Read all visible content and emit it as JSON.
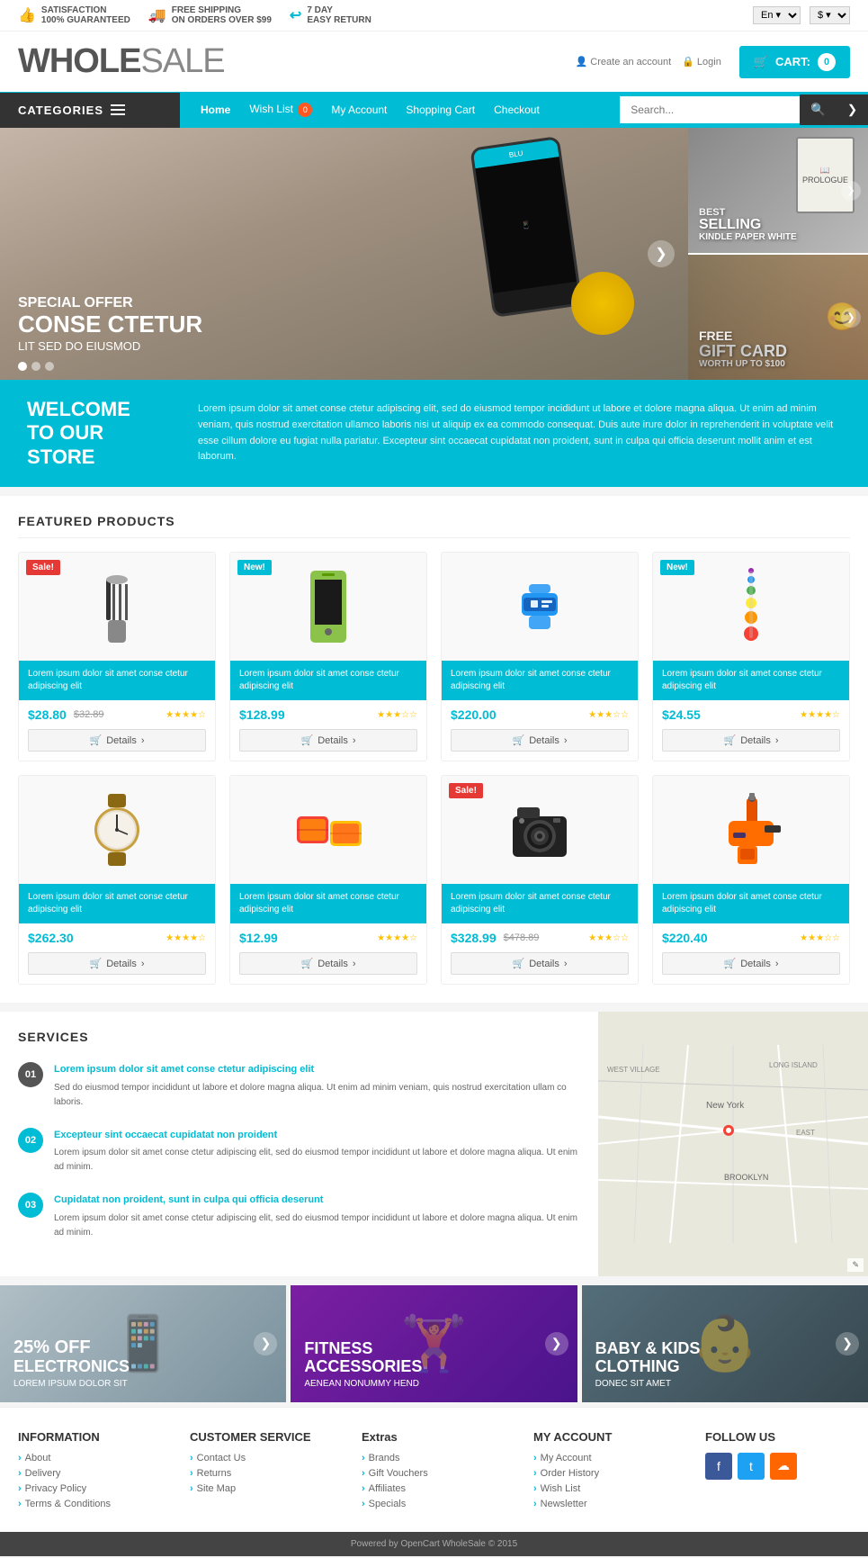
{
  "topbar": {
    "feature1_icon": "👍",
    "feature1_line1": "SATISFACTION",
    "feature1_line2": "100% GUARANTEED",
    "feature2_icon": "🚚",
    "feature2_line1": "FREE SHIPPING",
    "feature2_line2": "ON ORDERS OVER $99",
    "feature3_icon": "↩",
    "feature3_line1": "7 DAY",
    "feature3_line2": "EASY RETURN",
    "lang": "En",
    "currency": "$"
  },
  "header": {
    "logo_part1": "WHOLE",
    "logo_part2": "SALE",
    "create_account": "Create an account",
    "login": "Login",
    "cart_label": "CART:",
    "cart_count": "0"
  },
  "nav": {
    "categories_label": "CATEGORIES",
    "links": [
      {
        "label": "Home",
        "active": true,
        "badge": null
      },
      {
        "label": "Wish List",
        "active": false,
        "badge": "0"
      },
      {
        "label": "My Account",
        "active": false,
        "badge": null
      },
      {
        "label": "Shopping Cart",
        "active": false,
        "badge": null
      },
      {
        "label": "Checkout",
        "active": false,
        "badge": null
      }
    ],
    "search_placeholder": "Search..."
  },
  "hero": {
    "main": {
      "tag": "SPECIAL OFFER",
      "title": "CONSE CTETUR",
      "subtitle": "LIT SED DO EIUSMOD"
    },
    "side1": {
      "label": "BEST",
      "title": "SELLING",
      "sub": "KINDLE PAPER WHITE"
    },
    "side2": {
      "label": "FREE",
      "title": "GIFT CARD",
      "sub": "WORTH UP TO $100"
    }
  },
  "welcome": {
    "title": "WELCOME\nTO OUR STORE",
    "text": "Lorem ipsum dolor sit amet conse ctetur adipiscing elit, sed do eiusmod tempor incididunt ut labore et dolore magna aliqua. Ut enim ad minim veniam, quis nostrud exercitation ullamco laboris nisi ut aliquip ex ea commodo consequat. Duis aute irure dolor in reprehenderit in voluptate velit esse cillum dolore eu fugiat nulla pariatur. Excepteur sint occaecat cupidatat non proident, sunt in culpa qui officia deserunt mollit anim et est laborum."
  },
  "featured": {
    "title": "FEATURED PRODUCTS",
    "products": [
      {
        "badge": "Sale!",
        "badge_type": "sale",
        "img_type": "utensils",
        "desc": "Lorem ipsum dolor sit amet conse ctetur adipiscing elit",
        "price": "$28.80",
        "old_price": "$32.89",
        "stars": 4,
        "details_label": "Details"
      },
      {
        "badge": "New!",
        "badge_type": "new",
        "img_type": "phone",
        "desc": "Lorem ipsum dolor sit amet conse ctetur adipiscing elit",
        "price": "$128.99",
        "old_price": null,
        "stars": 3,
        "details_label": "Details"
      },
      {
        "badge": null,
        "badge_type": null,
        "img_type": "band",
        "desc": "Lorem ipsum dolor sit amet conse ctetur adipiscing elit",
        "price": "$220.00",
        "old_price": null,
        "stars": 3,
        "details_label": "Details"
      },
      {
        "badge": "New!",
        "badge_type": "new",
        "img_type": "toy",
        "desc": "Lorem ipsum dolor sit amet conse ctetur adipiscing elit",
        "price": "$24.55",
        "old_price": null,
        "stars": 4,
        "details_label": "Details"
      },
      {
        "badge": null,
        "badge_type": null,
        "img_type": "watch",
        "desc": "Lorem ipsum dolor sit amet conse ctetur adipiscing elit",
        "price": "$262.30",
        "old_price": null,
        "stars": 4,
        "details_label": "Details"
      },
      {
        "badge": null,
        "badge_type": null,
        "img_type": "pillows",
        "desc": "Lorem ipsum dolor sit amet conse ctetur adipiscing elit",
        "price": "$12.99",
        "old_price": null,
        "stars": 4,
        "details_label": "Details"
      },
      {
        "badge": "Sale!",
        "badge_type": "sale",
        "img_type": "camera",
        "desc": "Lorem ipsum dolor sit amet conse ctetur adipiscing elit",
        "price": "$328.99",
        "old_price": "$478.89",
        "stars": 3,
        "details_label": "Details"
      },
      {
        "badge": null,
        "badge_type": null,
        "img_type": "drill",
        "desc": "Lorem ipsum dolor sit amet conse ctetur adipiscing elit",
        "price": "$220.40",
        "old_price": null,
        "stars": 3,
        "details_label": "Details"
      }
    ]
  },
  "services": {
    "title": "SERVICES",
    "items": [
      {
        "num": "01",
        "highlight": "Lorem ipsum dolor sit amet conse ctetur adipiscing elit",
        "text": "Sed do eiusmod tempor incididunt ut labore et dolore magna aliqua. Ut enim ad minim veniam, quis nostrud exercitation ullam co laboris."
      },
      {
        "num": "02",
        "highlight": "Excepteur sint occaecat cupidatat non proident",
        "text": "Lorem ipsum dolor sit amet conse ctetur adipiscing elit, sed do eiusmod tempor incididunt ut labore et dolore magna aliqua. Ut enim ad minim."
      },
      {
        "num": "03",
        "highlight": "Cupidatat non proident, sunt in culpa qui officia deserunt",
        "text": "Lorem ipsum dolor sit amet conse ctetur adipiscing elit, sed do eiusmod tempor incididunt ut labore et dolore magna aliqua. Ut enim ad minim."
      }
    ]
  },
  "promos": [
    {
      "discount": "25% OFF",
      "category": "ELECTRONICS",
      "sub": "LOREM IPSUM DOLOR SIT"
    },
    {
      "discount": "",
      "category": "FITNESS\nACCESSORIES",
      "sub": "AENEAN NONUMMY HEND"
    },
    {
      "discount": "",
      "category": "BABY & KIDS\nCLOTHING",
      "sub": "DONEC SIT AMET"
    }
  ],
  "footer": {
    "cols": [
      {
        "heading": "INFORMATION",
        "links": [
          "About",
          "Delivery",
          "Privacy Policy",
          "Terms & Conditions"
        ]
      },
      {
        "heading": "CUSTOMER SERVICE",
        "links": [
          "Contact Us",
          "Returns",
          "Site Map"
        ]
      },
      {
        "heading": "Extras",
        "links": [
          "Brands",
          "Gift Vouchers",
          "Affiliates",
          "Specials"
        ]
      },
      {
        "heading": "MY ACCOUNT",
        "links": [
          "My Account",
          "Order History",
          "Wish List",
          "Newsletter"
        ]
      },
      {
        "heading": "FOLLOW US",
        "social": [
          "f",
          "t",
          "rss"
        ]
      }
    ],
    "copyright": "Powered by OpenCart WholeSale © 2015"
  }
}
